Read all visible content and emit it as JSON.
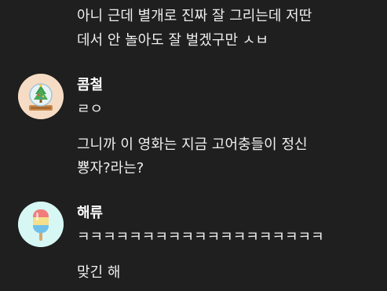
{
  "messages": [
    {
      "lines": [
        "아니 근데 별개로 진짜 잘 그리는데 저딴",
        "데서 안 놀아도 잘 벌겠구만 ㅅㅂ"
      ]
    },
    {
      "author": "콤철",
      "avatar_icon": "snow-globe-tree-icon",
      "lines": [
        "ㄹㅇ"
      ]
    },
    {
      "lines": [
        "그니까 이 영화는 지금 고어충들이 정신",
        "뿅자?라는?"
      ]
    },
    {
      "author": "해류",
      "avatar_icon": "popsicle-icon",
      "lines": [
        "ㅋㅋㅋㅋㅋㅋㅋㅋㅋㅋㅋㅋㅋㅋㅋㅋㅋㅋㅋ"
      ]
    },
    {
      "lines": [
        "맞긴 해"
      ]
    }
  ],
  "colors": {
    "background": "#1f1f1f",
    "text": "#eeeeee",
    "author": "#ffffff",
    "avatar1_bg": "#f6dcc4",
    "avatar2_bg": "#d6f7f3"
  }
}
